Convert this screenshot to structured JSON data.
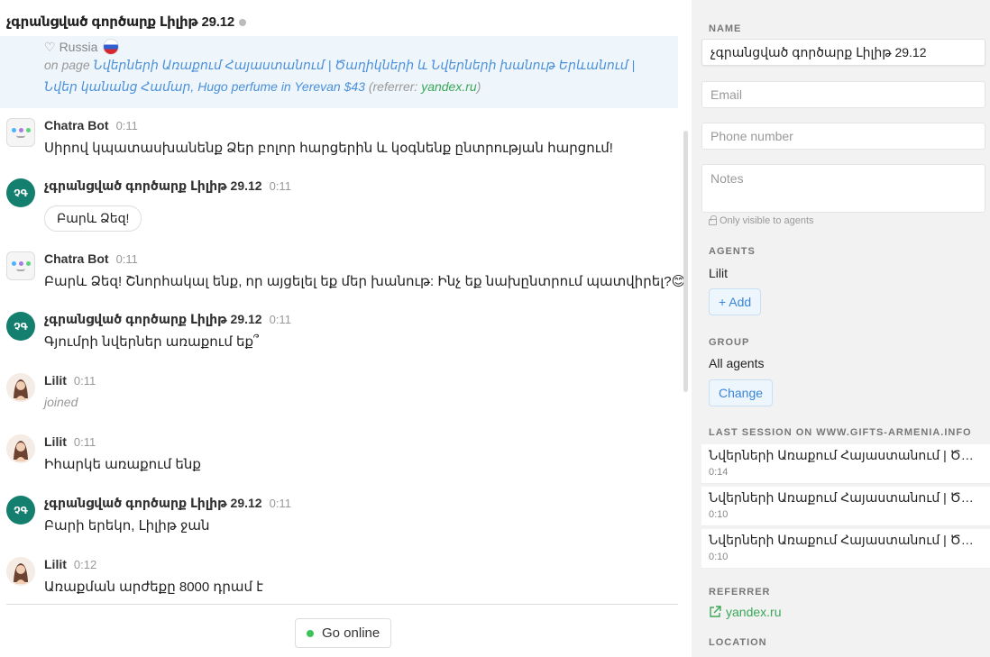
{
  "header": {
    "visitor_name": "չգրանցված գործարք Լիլիթ 29.12"
  },
  "visitor_info": {
    "country": "Russia",
    "on_page_prefix": "on page",
    "page_title_1": "Նվերների Առաքում Հայաստանում | Ծաղիկների և Նվերների խանութ Երևանում |",
    "page_title_2": "Նվեր կանանց Համար, Hugo perfume in Yerevan $43",
    "referrer_prefix": "(referrer:",
    "referrer": "yandex.ru",
    "referrer_suffix": ")"
  },
  "messages": [
    {
      "author": "Chatra Bot",
      "time": "0:11",
      "text": "Սիրով կպատասխանենք Ձեր բոլոր հարցերին և կօգնենք ընտրության հարցում!"
    },
    {
      "author": "չգրանցված գործարք Լիլիթ 29.12",
      "time": "0:11",
      "text": "Բարև Ձեզ!",
      "initials": "ՉԳ"
    },
    {
      "author": "Chatra Bot",
      "time": "0:11",
      "text": "Բարև Ձեզ! Շնորհակալ ենք, որ այցելել եք մեր խանութ: Ինչ եք նախընտրում պատվիրել?😊"
    },
    {
      "author": "չգրանցված գործարք Լիլիթ 29.12",
      "time": "0:11",
      "text": "Գյումրի նվերներ առաքում եք՞",
      "initials": "ՉԳ"
    },
    {
      "author": "Lilit",
      "time": "0:11",
      "text": "joined"
    },
    {
      "author": "Lilit",
      "time": "0:11",
      "text": "Իհարկե առաքում ենք"
    },
    {
      "author": "չգրանցված գործարք Լիլիթ 29.12",
      "time": "0:11",
      "text": "Բարի երեկո, Լիլիթ ջան",
      "initials": "ՉԳ"
    },
    {
      "author": "Lilit",
      "time": "0:12",
      "text": "Առաքման արժեքը 8000 դրամ է"
    }
  ],
  "footer": {
    "go_online": "Go online",
    "status_color": "#3ec25a"
  },
  "sidebar": {
    "name_label": "NAME",
    "name_value": "չգրանցված գործարք Լիլիթ 29.12",
    "email_placeholder": "Email",
    "phone_placeholder": "Phone number",
    "notes_placeholder": "Notes",
    "notes_hint": "Only visible to agents",
    "agents_label": "AGENTS",
    "agent_name": "Lilit",
    "add_button": "+ Add",
    "group_label": "GROUP",
    "group_value": "All agents",
    "change_button": "Change",
    "last_session_label": "LAST SESSION ON WWW.GIFTS-ARMENIA.INFO",
    "sessions": [
      {
        "title": "Նվերների Առաքում Հայաստանում | Ծաղիկների և Նվերների խանութ",
        "time": "0:14"
      },
      {
        "title": "Նվերների Առաքում Հայաստանում | Ծաղիկների և Նվերների խանութ",
        "time": "0:10"
      },
      {
        "title": "Նվերների Առաքում Հայաստանում | Ծաղիկների և Նվերների խանութ",
        "time": "0:10"
      }
    ],
    "referrer_label": "REFERRER",
    "referrer_value": "yandex.ru",
    "location_label": "LOCATION"
  },
  "colors": {
    "accent": "#3a85d8",
    "visitor_avatar": "#157f6f",
    "referrer_green": "#3aa757",
    "highlight_bg": "#eef5fb"
  }
}
